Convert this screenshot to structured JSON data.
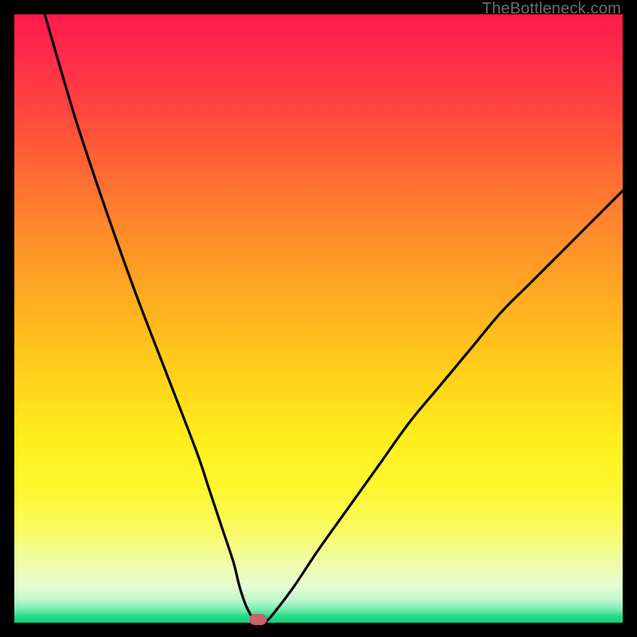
{
  "watermark": "TheBottleneck.com",
  "colors": {
    "frame": "#000000",
    "curve": "#000000",
    "marker": "#c8636a",
    "gradient_top": "#ff1a4d",
    "gradient_bottom": "#09d67e"
  },
  "chart_data": {
    "type": "line",
    "title": "",
    "xlabel": "",
    "ylabel": "",
    "xlim": [
      0,
      100
    ],
    "ylim": [
      0,
      100
    ],
    "grid": false,
    "legend": false,
    "series": [
      {
        "name": "bottleneck-curve",
        "x": [
          5,
          10,
          15,
          20,
          25,
          30,
          32,
          34,
          36,
          37,
          38,
          39,
          39.5,
          40,
          40.5,
          41.5,
          43,
          46,
          50,
          55,
          60,
          65,
          70,
          75,
          80,
          85,
          90,
          95,
          100
        ],
        "y": [
          100,
          83,
          68,
          54,
          41,
          28,
          22,
          16,
          10,
          6,
          3,
          1,
          0.3,
          0,
          0,
          0.3,
          2,
          6,
          12,
          19,
          26,
          33,
          39,
          45,
          51,
          56,
          61,
          66,
          71
        ]
      }
    ],
    "marker": {
      "x": 40,
      "y": 0
    },
    "background_gradient": {
      "stops": [
        {
          "pos": 0,
          "color": "#ff1a4d"
        },
        {
          "pos": 50,
          "color": "#ffb020"
        },
        {
          "pos": 80,
          "color": "#fdf82f"
        },
        {
          "pos": 100,
          "color": "#09d67e"
        }
      ]
    }
  }
}
